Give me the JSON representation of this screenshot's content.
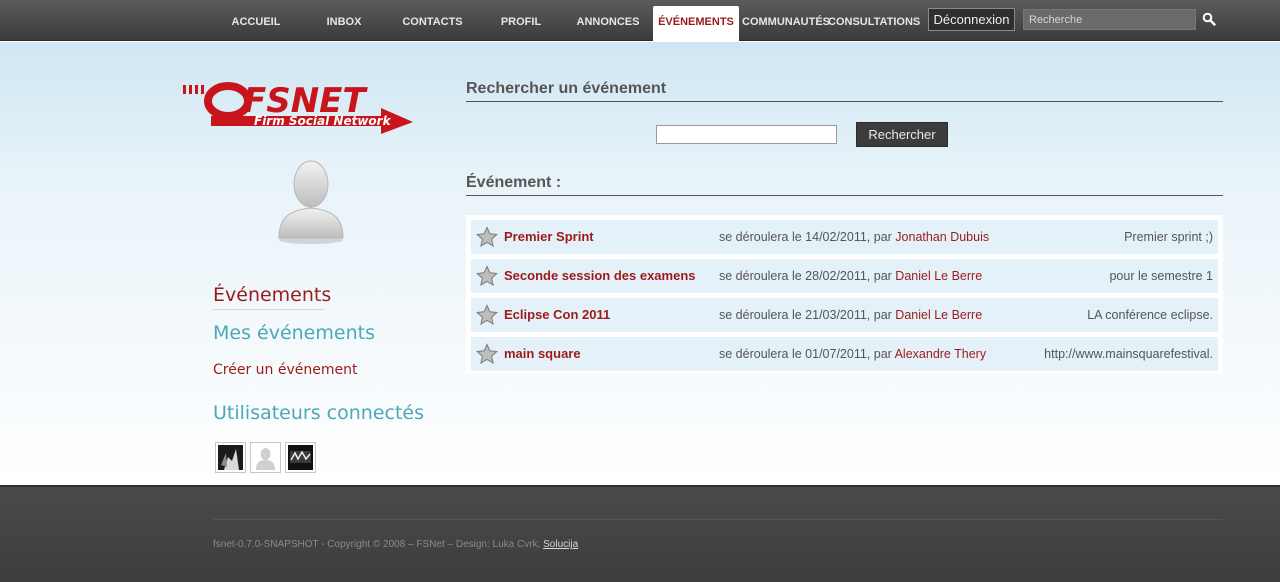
{
  "nav": {
    "items": [
      {
        "label": "ACCUEIL"
      },
      {
        "label": "INBOX"
      },
      {
        "label": "CONTACTS"
      },
      {
        "label": "PROFIL"
      },
      {
        "label": "ANNONCES"
      },
      {
        "label": "ÉVÉNEMENTS",
        "active": true
      },
      {
        "label": "COMMUNAUTÉS"
      },
      {
        "label": "CONSULTATIONS"
      }
    ],
    "logout_label": "Déconnexion",
    "search_placeholder": "Recherche"
  },
  "logo": {
    "name": "FSNET",
    "tagline": "Firm Social Network"
  },
  "sidebar": {
    "events_label": "Événements",
    "my_events_label": "Mes événements",
    "create_event_label": "Créer un événement",
    "connected_users_label": "Utilisateurs connectés"
  },
  "search_section": {
    "title": "Rechercher un événement",
    "input_value": "",
    "button_label": "Rechercher"
  },
  "events_section": {
    "title": "Événement :",
    "events": [
      {
        "title": "Premier Sprint",
        "date_text": "se déroulera le 14/02/2011, par ",
        "author": "Jonathan Dubuis",
        "description": "Premier sprint ;)"
      },
      {
        "title": "Seconde session des examens",
        "date_text": "se déroulera le 28/02/2011, par ",
        "author": "Daniel Le Berre",
        "description": "pour le semestre 1"
      },
      {
        "title": "Eclipse Con 2011",
        "date_text": "se déroulera le 21/03/2011, par ",
        "author": "Daniel Le Berre",
        "description": "LA conférence eclipse."
      },
      {
        "title": "main square",
        "date_text": "se déroulera le 01/07/2011, par ",
        "author": "Alexandre Thery",
        "description": "http://www.mainsquarefestival."
      }
    ]
  },
  "footer": {
    "text": "fsnet-0.7.0-SNAPSHOT - Copyright © 2008 – FSNet – Design: Luka Cvrk, ",
    "link_label": "Solucija"
  },
  "colors": {
    "brand_red": "#9b1b1b",
    "teal": "#4aa8b8",
    "nav_bg": "#4a4a4a"
  }
}
